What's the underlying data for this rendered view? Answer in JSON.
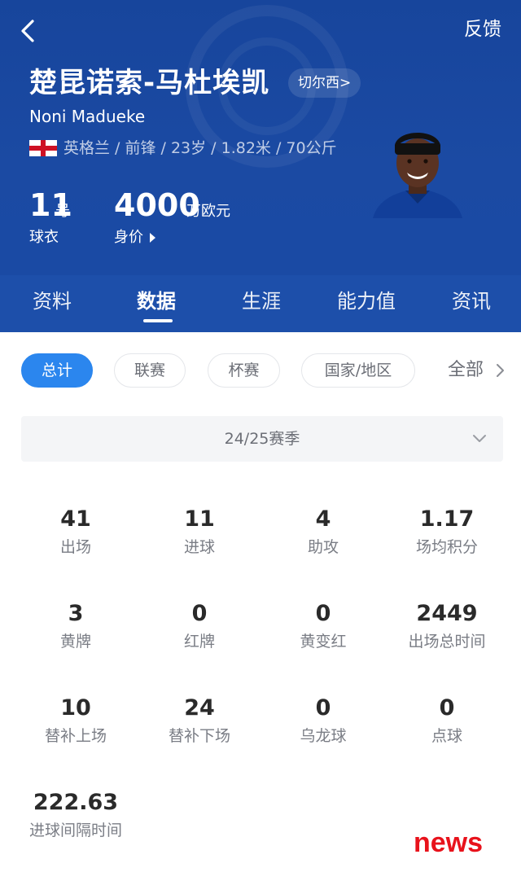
{
  "header": {
    "feedback_label": "反馈",
    "player_name_cn": "楚昆诺索-马杜埃凯",
    "club_link": "切尔西>",
    "player_name_en": "Noni Madueke",
    "info_line": "英格兰 / 前锋 / 23岁 / 1.82米 / 70公斤",
    "jersey_number": "11",
    "jersey_unit": "号",
    "jersey_label": "球衣",
    "market_value": "4000",
    "market_value_unit": "万欧元",
    "market_value_label": "身价",
    "colors": {
      "header_bg": "#1a4aa4",
      "tab_bg": "#1d4faa"
    }
  },
  "tabs": [
    {
      "label": "资料"
    },
    {
      "label": "数据",
      "active": true
    },
    {
      "label": "生涯"
    },
    {
      "label": "能力值"
    },
    {
      "label": "资讯"
    }
  ],
  "filters": {
    "chips": [
      {
        "label": "总计",
        "active": true
      },
      {
        "label": "联赛"
      },
      {
        "label": "杯赛"
      },
      {
        "label": "国家/地区"
      }
    ],
    "all_label": "全部",
    "accent": "#2b86ee"
  },
  "season": {
    "selected": "24/25赛季"
  },
  "stats": [
    {
      "value": "41",
      "label": "出场"
    },
    {
      "value": "11",
      "label": "进球"
    },
    {
      "value": "4",
      "label": "助攻"
    },
    {
      "value": "1.17",
      "label": "场均积分"
    },
    {
      "value": "3",
      "label": "黄牌"
    },
    {
      "value": "0",
      "label": "红牌"
    },
    {
      "value": "0",
      "label": "黄变红"
    },
    {
      "value": "2449",
      "label": "出场总时间"
    },
    {
      "value": "10",
      "label": "替补上场"
    },
    {
      "value": "24",
      "label": "替补下场"
    },
    {
      "value": "0",
      "label": "乌龙球"
    },
    {
      "value": "0",
      "label": "点球"
    },
    {
      "value": "222.63",
      "label": "进球间隔时间"
    }
  ],
  "watermark": "news"
}
